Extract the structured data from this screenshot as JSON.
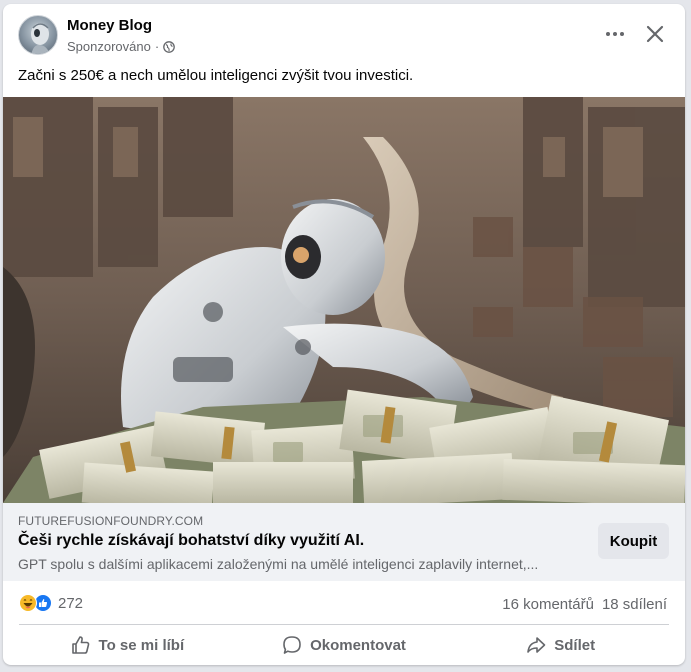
{
  "post": {
    "page_name": "Money Blog",
    "sponsored_label": "Sponzorováno",
    "separator": "·",
    "text": "Začni s 250€ a nech umělou inteligenci zvýšit tvou investici."
  },
  "link_preview": {
    "domain": "FUTUREFUSIONFOUNDRY.COM",
    "title": "Češi rychle získávají bohatství díky využití AI.",
    "description": "GPT spolu s dalšími aplikacemi založenými na umělé inteligenci zaplavily internet,...",
    "cta_label": "Koupit"
  },
  "stats": {
    "reaction_count": "272",
    "comments": "16 komentářů",
    "shares": "18 sdílení"
  },
  "actions": {
    "like": "To se mi líbí",
    "comment": "Okomentovat",
    "share": "Sdílet"
  },
  "icons": {
    "more": "more-horizontal-icon",
    "close": "close-icon",
    "globe": "globe-icon",
    "like": "thumbs-up-icon",
    "comment": "comment-bubble-icon",
    "share": "share-arrow-icon"
  },
  "colors": {
    "like_blue": "#1877f2",
    "haha_yellow": "#f7b928",
    "muted_text": "#65676b",
    "link_box_bg": "#f0f2f5"
  }
}
